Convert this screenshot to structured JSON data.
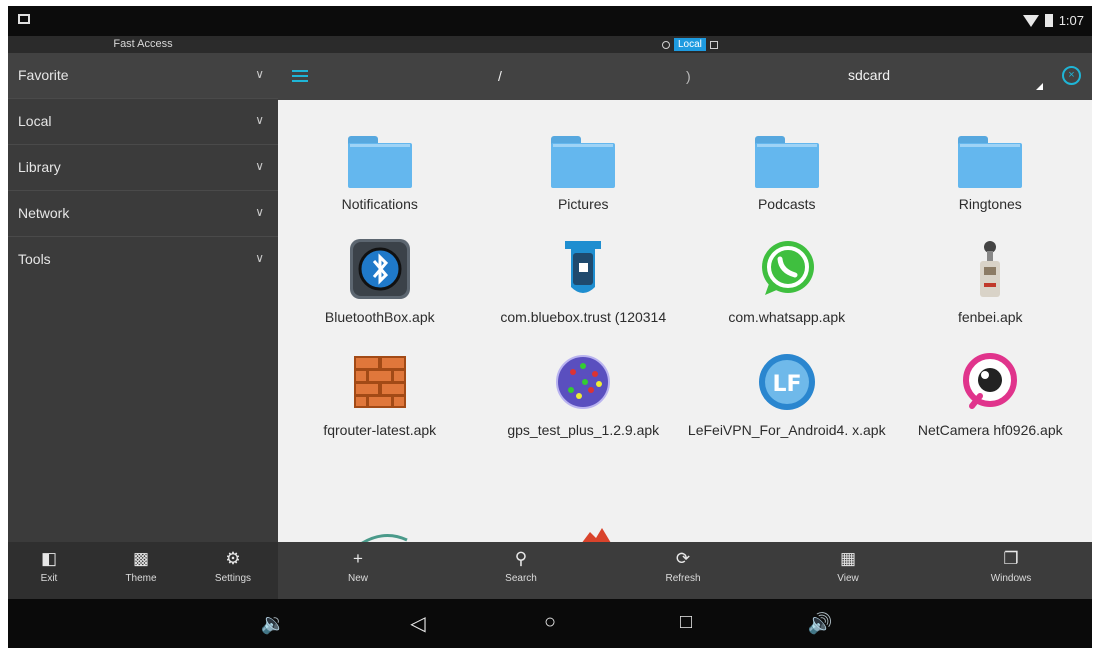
{
  "status_bar": {
    "time": "1:07",
    "wifi_icon": "wifi-icon",
    "battery_icon": "battery-icon"
  },
  "sidebar": {
    "title": "Fast Access",
    "items": [
      {
        "label": "Favorite"
      },
      {
        "label": "Local"
      },
      {
        "label": "Library"
      },
      {
        "label": "Network"
      },
      {
        "label": "Tools"
      }
    ]
  },
  "tab": {
    "label": "Local"
  },
  "path": {
    "root": "/",
    "separator": ")",
    "current": "sdcard"
  },
  "files": [
    {
      "label": "Notifications",
      "icon": "folder-icon"
    },
    {
      "label": "Pictures",
      "icon": "folder-icon"
    },
    {
      "label": "Podcasts",
      "icon": "folder-icon"
    },
    {
      "label": "Ringtones",
      "icon": "folder-icon"
    },
    {
      "label": "BluetoothBox.apk",
      "icon": "bluetooth-app-icon"
    },
    {
      "label": "com.bluebox.trust (120314",
      "icon": "bluebox-app-icon"
    },
    {
      "label": "com.whatsapp.apk",
      "icon": "whatsapp-app-icon"
    },
    {
      "label": "fenbei.apk",
      "icon": "sound-meter-app-icon"
    },
    {
      "label": "fqrouter-latest.apk",
      "icon": "brick-wall-app-icon"
    },
    {
      "label": "gps_test_plus_1.2.9.apk",
      "icon": "gps-app-icon"
    },
    {
      "label": "LeFeiVPN_For_Android4. x.apk",
      "icon": "lefei-vpn-app-icon"
    },
    {
      "label": "NetCamera hf0926.apk",
      "icon": "camera-app-icon"
    }
  ],
  "toolbar": {
    "exit": "Exit",
    "theme": "Theme",
    "settings": "Settings",
    "new": "New",
    "search": "Search",
    "refresh": "Refresh",
    "view": "View",
    "windows": "Windows"
  },
  "navbar": [
    "volume-down-icon",
    "back-icon",
    "home-icon",
    "recents-icon",
    "volume-up-icon"
  ]
}
